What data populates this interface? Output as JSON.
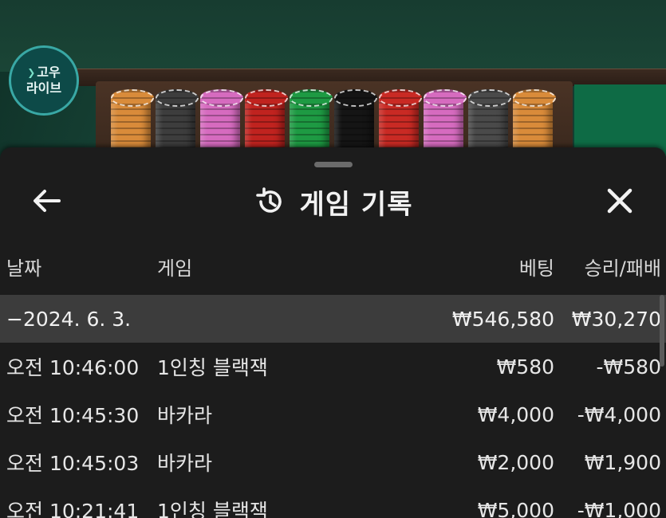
{
  "logo": {
    "line1": "고우",
    "line2": "라이브"
  },
  "sheet": {
    "title": "게임 기록"
  },
  "table": {
    "headers": {
      "date": "날짜",
      "game": "게임",
      "bet": "베팅",
      "result": "승리/패배"
    },
    "day": {
      "date": "−2024. 6. 3.",
      "bet": "₩546,580",
      "result": "₩30,270"
    },
    "rows": [
      {
        "time": "오전 10:46:00",
        "game": "1인칭 블랙잭",
        "bet": "₩580",
        "result": "-₩580"
      },
      {
        "time": "오전 10:45:30",
        "game": "바카라",
        "bet": "₩4,000",
        "result": "-₩4,000"
      },
      {
        "time": "오전 10:45:03",
        "game": "바카라",
        "bet": "₩2,000",
        "result": "₩1,900"
      },
      {
        "time": "오전 10:21:41",
        "game": "1인칭 블랙잭",
        "bet": "₩5,000",
        "result": "-₩1,000"
      }
    ]
  },
  "chips": [
    {
      "color": "#d98b3a"
    },
    {
      "color": "#3d3d3d"
    },
    {
      "color": "#d66bbf"
    },
    {
      "color": "#c0231f"
    },
    {
      "color": "#1e9a43"
    },
    {
      "color": "#151515"
    },
    {
      "color": "#c92a24"
    },
    {
      "color": "#d66bbf"
    },
    {
      "color": "#4a4a4a"
    },
    {
      "color": "#d98b3a"
    }
  ],
  "icons": {
    "back": "arrow-left-icon",
    "history": "history-icon",
    "close": "close-icon"
  }
}
